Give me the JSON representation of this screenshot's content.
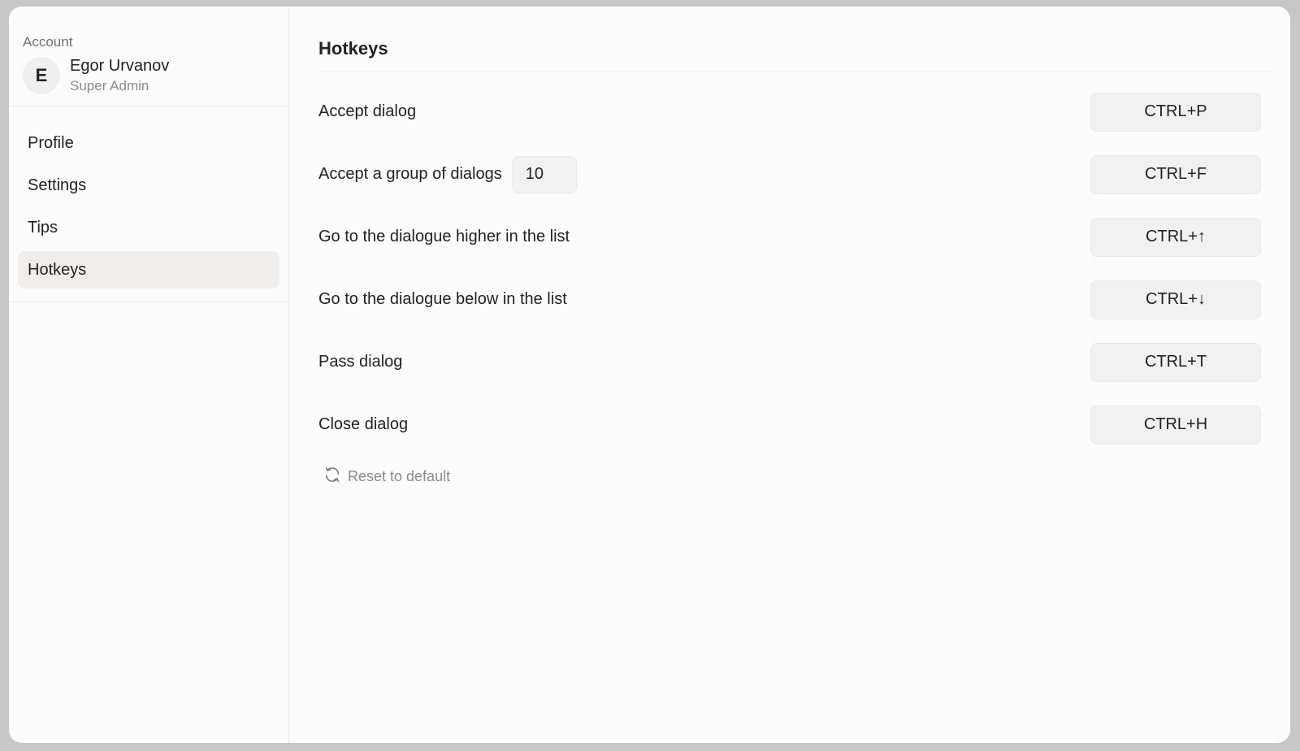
{
  "sidebar": {
    "account_heading": "Account",
    "user": {
      "initial": "E",
      "name": "Egor Urvanov",
      "role": "Super Admin"
    },
    "nav": [
      {
        "label": "Profile",
        "active": false
      },
      {
        "label": "Settings",
        "active": false
      },
      {
        "label": "Tips",
        "active": false
      },
      {
        "label": "Hotkeys",
        "active": true
      }
    ]
  },
  "main": {
    "title": "Hotkeys",
    "hotkeys": [
      {
        "label": "Accept dialog",
        "key": "CTRL+P"
      },
      {
        "label": "Accept a group of dialogs",
        "count": "10",
        "key": "CTRL+F"
      },
      {
        "label": "Go to the dialogue higher in the list",
        "key": "CTRL+↑"
      },
      {
        "label": "Go to the dialogue below in the list",
        "key": "CTRL+↓"
      },
      {
        "label": "Pass dialog",
        "key": "CTRL+T"
      },
      {
        "label": "Close dialog",
        "key": "CTRL+H"
      }
    ],
    "reset_label": "Reset to default"
  },
  "colors": {
    "active_nav_bg": "#efeeed",
    "key_bg": "#f1f1f1",
    "muted_text": "#8a8a8a"
  }
}
